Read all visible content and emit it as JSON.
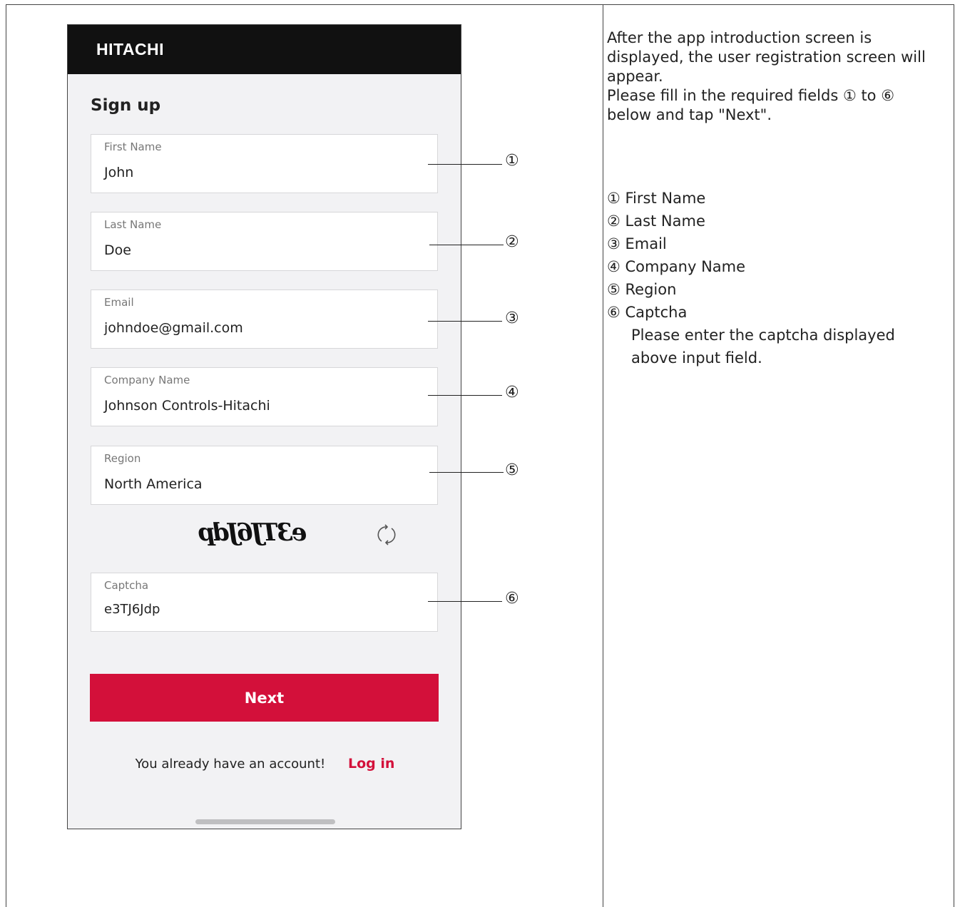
{
  "header": {
    "brand": "HITACHI"
  },
  "form": {
    "title": "Sign up",
    "fields": [
      {
        "label": "First Name",
        "value": "John"
      },
      {
        "label": "Last Name",
        "value": "Doe"
      },
      {
        "label": "Email",
        "value": "johndoe@gmail.com"
      },
      {
        "label": "Company Name",
        "value": "Johnson Controls-Hitachi"
      },
      {
        "label": "Region",
        "value": "North America"
      },
      {
        "label": "Captcha",
        "value": "e3TJ6Jdp"
      }
    ],
    "captcha_image_text": "e3TJ6Jdp",
    "next_label": "Next",
    "account_text": "You already have an account!",
    "login_label": "Log in"
  },
  "callouts": [
    "①",
    "②",
    "③",
    "④",
    "⑤",
    "⑥"
  ],
  "instructions": {
    "lines": [
      "After the app introduction screen is",
      "displayed, the user registration screen will",
      "appear.",
      "Please fill in the required fields ① to ⑥",
      "below and tap \"Next\"."
    ],
    "legend": [
      "① First Name",
      "② Last Name",
      "③ Email",
      "④ Company Name",
      "⑤ Region",
      "⑥ Captcha"
    ],
    "captcha_note": [
      "Please enter the captcha displayed",
      "above input field."
    ]
  },
  "colors": {
    "accent": "#d3103a",
    "header_bg": "#111111",
    "screen_bg": "#f2f2f4"
  },
  "icons": {
    "refresh": "refresh-icon"
  }
}
